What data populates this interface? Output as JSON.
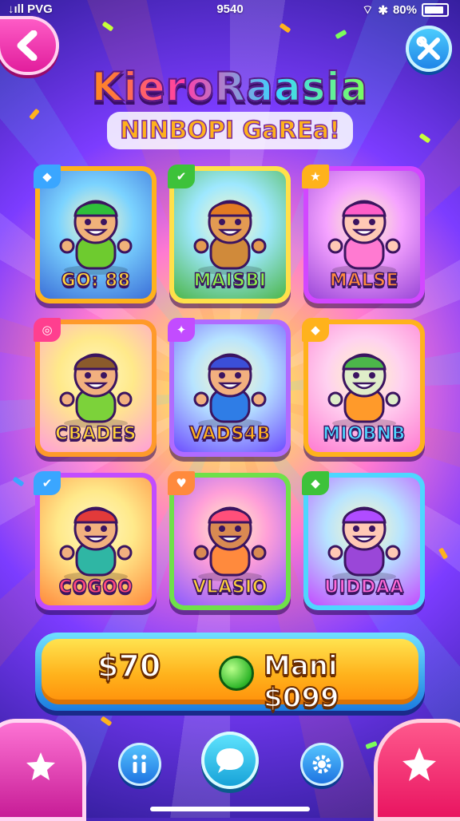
{
  "status_bar": {
    "carrier": "↓ıll PVG",
    "time": "9540",
    "battery": "80%"
  },
  "header": {
    "title": "KieroRaasia",
    "subtitle": "NINBOPI GaREa!"
  },
  "colors": {
    "gold": "#ffb21c",
    "purple": "#7c3cff",
    "pink": "#ff5fc8",
    "blue": "#1c7fe6"
  },
  "characters": [
    {
      "label": "GO: 88",
      "label_color": "#ffd23a",
      "frame": "#ffb21c",
      "bg": [
        "#7bd3ff",
        "#3b6fd8"
      ],
      "tag_icon": "◆",
      "tag_color": "#3aa6ff",
      "skin": "#f0b27a",
      "hat": "#2fbf3a",
      "shirt": "#6ecb2f"
    },
    {
      "label": "MAISBI",
      "label_color": "#8cf04a",
      "frame": "#ffe14a",
      "bg": [
        "#9ee8ff",
        "#4cb64a"
      ],
      "tag_icon": "✔",
      "tag_color": "#3dc23a",
      "skin": "#e39a52",
      "hat": "#e37a22",
      "shirt": "#d08a3a"
    },
    {
      "label": "MALSE",
      "label_color": "#ff8a3d",
      "frame": "#d247ff",
      "bg": [
        "#f5a3ff",
        "#9a47d8"
      ],
      "tag_icon": "★",
      "tag_color": "#ffb21c",
      "skin": "#ffc9b5",
      "hat": "#ff5fc8",
      "shirt": "#ff7ad1"
    },
    {
      "label": "CBADES",
      "label_color": "#ffd23a",
      "frame": "#ff9a2a",
      "bg": [
        "#ffe98a",
        "#ff9fd8"
      ],
      "tag_icon": "◎",
      "tag_color": "#ff3f8f",
      "skin": "#f2b07f",
      "hat": "#8a5a2b",
      "shirt": "#7cd23a"
    },
    {
      "label": "VADS4B",
      "label_color": "#ffb21c",
      "frame": "#b06bff",
      "bg": [
        "#b7e4ff",
        "#6c4cff"
      ],
      "tag_icon": "✦",
      "tag_color": "#c24cff",
      "skin": "#f2b07f",
      "hat": "#3b4fd8",
      "shirt": "#2f7de6"
    },
    {
      "label": "MIOBNB",
      "label_color": "#4ed6ff",
      "frame": "#ffb21c",
      "bg": [
        "#ffd1f0",
        "#ff7ad1"
      ],
      "tag_icon": "◆",
      "tag_color": "#ffb21c",
      "skin": "#dfeec9",
      "hat": "#4cb64a",
      "shirt": "#ff9a2a"
    },
    {
      "label": "COGOO",
      "label_color": "#ff4a7a",
      "frame": "#c24cff",
      "bg": [
        "#ffe98a",
        "#ff8a3d"
      ],
      "tag_icon": "✔",
      "tag_color": "#3aa6ff",
      "skin": "#f2b07f",
      "hat": "#e23a3a",
      "shirt": "#2fb6a4"
    },
    {
      "label": "VLASIO",
      "label_color": "#ffd23a",
      "frame": "#6fe04a",
      "bg": [
        "#ff9fd8",
        "#8a5aff"
      ],
      "tag_icon": "♥",
      "tag_color": "#ff8a3d",
      "skin": "#d98a52",
      "hat": "#ff4f7a",
      "shirt": "#ff8a3d"
    },
    {
      "label": "UIDDAA",
      "label_color": "#ff6ad8",
      "frame": "#4ed6ff",
      "bg": [
        "#b7e4ff",
        "#c24cff"
      ],
      "tag_icon": "◆",
      "tag_color": "#3dc23a",
      "skin": "#ffc9b5",
      "hat": "#b04cff",
      "shirt": "#9a47d8"
    }
  ],
  "purchase": {
    "price_left": "$70",
    "price_right": "Mani $099"
  },
  "nav": {
    "left_icon": "star-home-icon",
    "info_icon": "info-icon",
    "chat_icon": "chat-bubble-icon",
    "settings_icon": "gear-icon",
    "right_icon": "sparkle-star-icon"
  }
}
